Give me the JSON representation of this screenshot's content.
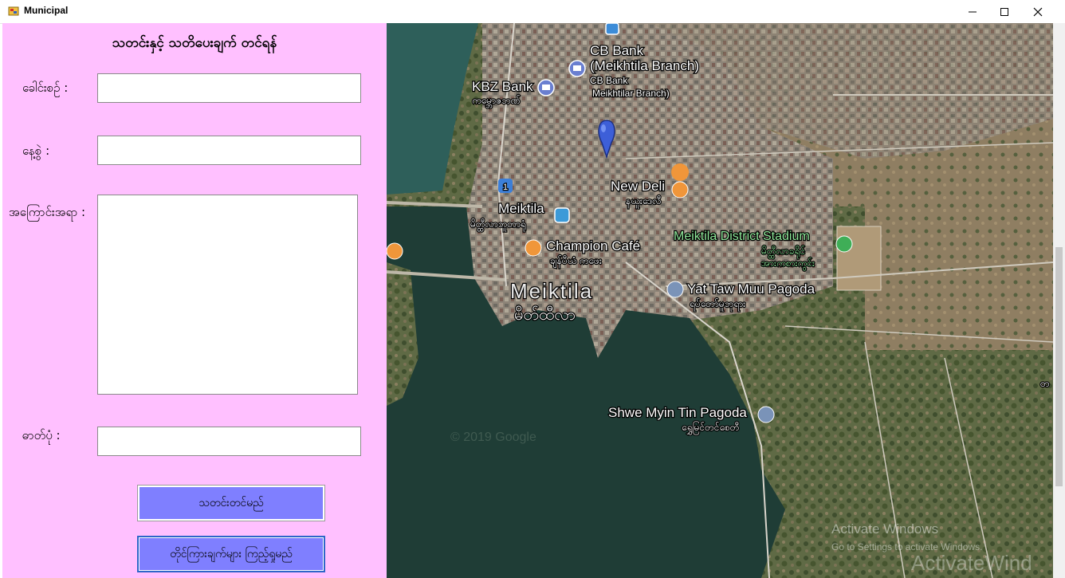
{
  "window": {
    "title": "Municipal",
    "minimize_icon": "minimize-icon",
    "maximize_icon": "maximize-icon",
    "close_icon": "close-icon"
  },
  "form": {
    "heading": "သတင်းနှင့် သတိပေးချက် တင်ရန်",
    "title_label": "ခေါင်းစဉ် :",
    "title_value": "",
    "date_label": "နေ့စွဲ :",
    "date_value": "",
    "content_label": "အကြောင်းအရာ :",
    "content_value": "",
    "photo_label": "ဓာတ်ပုံ :",
    "photo_value": "",
    "submit_button": "သတင်းတင်မည်",
    "view_button": "တိုင်ကြားချက်များ ကြည့်ရှုမည်",
    "background_color": "#ffc0ff",
    "button_color": "#7f7fff"
  },
  "map": {
    "labels": {
      "cb_bank": "CB Bank",
      "cb_bank_branch": "(Meikhtila Branch)",
      "cb_bank_mm1": "CB Bank",
      "cb_bank_mm2": "Meikhtilar Branch)",
      "kbz_bank": "KBZ Bank",
      "kbz_bank_mm": "ကမ္ဘောဇဘဏ်",
      "new_deli": "New Deli",
      "new_deli_mm": "နယူးဒေလီ",
      "meiktila_station": "Meiktila",
      "meiktila_station_mm": "မိတ္ထီလာဘူတာရုံ",
      "champion_cafe": "Champion Café",
      "champion_cafe_mm": "ချန်ပီယံ ကဖေး",
      "stadium": "Meiktila District Stadium",
      "stadium_mm1": "မိတ္ထီလာခရိုင်",
      "stadium_mm2": "အားကစားကွင်း",
      "city": "Meiktila",
      "city_mm": "မိတ်ထီလာ",
      "yat_taw_muu": "Yat Taw Muu Pagoda",
      "yat_taw_muu_mm": "ရပ်တော်မူဘုရား",
      "shwe_myin_tin": "Shwe Myin Tin Pagoda",
      "shwe_myin_tin_mm": "ရွှေမြင်တင်စေတီ",
      "copyright": "© 2019 Google",
      "route_number": "1",
      "edge_label": "တ"
    },
    "marker_icon": "map-marker-icon"
  },
  "watermark": {
    "line1": "Activate Windows",
    "line2": "Go to Settings to activate Windows.",
    "line3": "ActivateWind"
  }
}
